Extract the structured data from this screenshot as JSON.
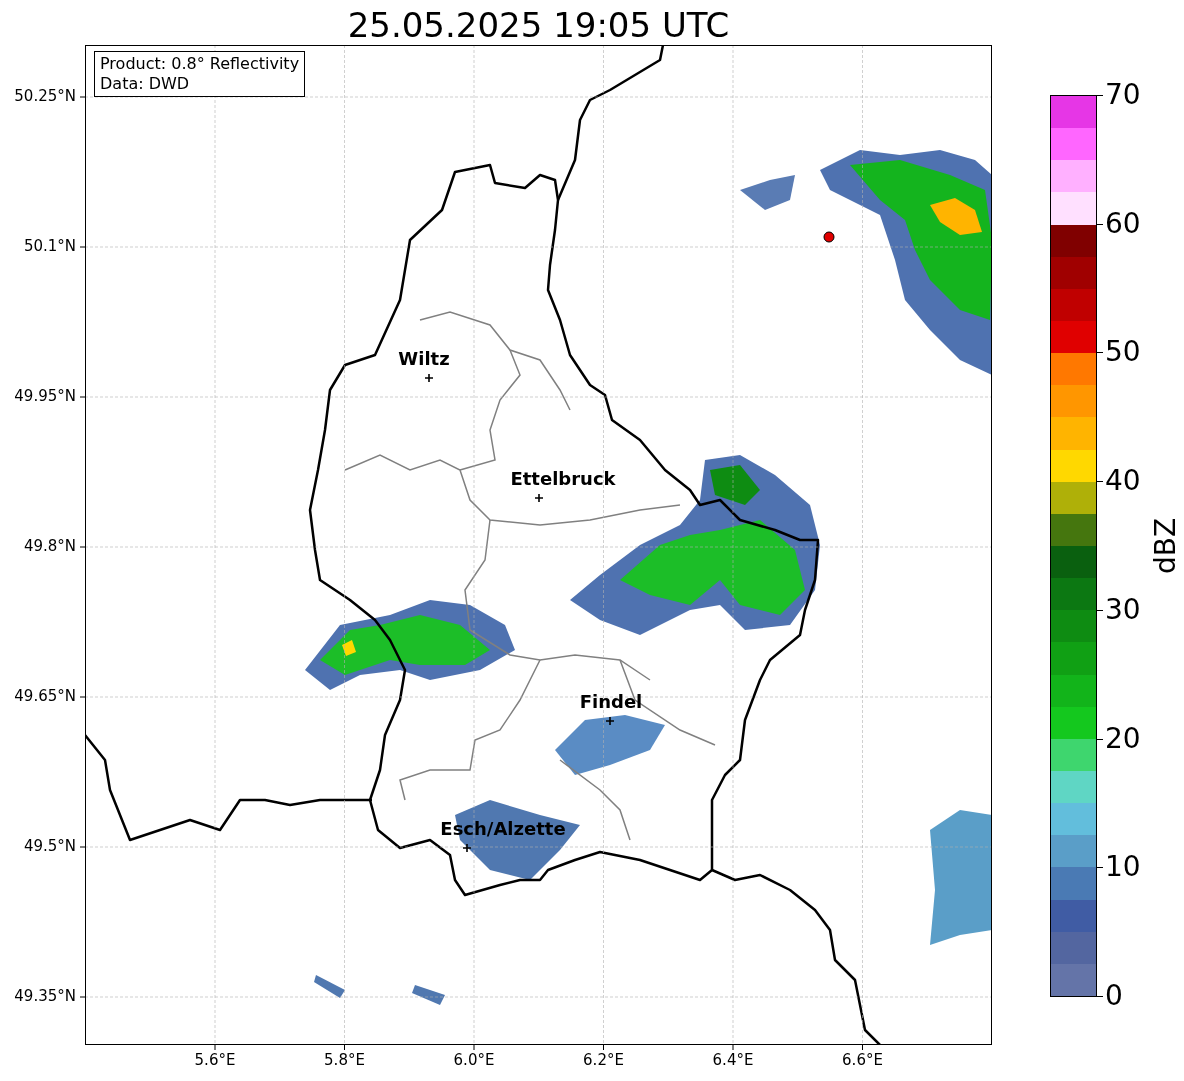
{
  "title": "25.05.2025 19:05 UTC",
  "info_box": {
    "lines": [
      "Product: 0.8° Reflectivity",
      "Data: DWD"
    ]
  },
  "map": {
    "yticks": [
      "50.25°N",
      "50.1°N",
      "49.95°N",
      "49.8°N",
      "49.65°N",
      "49.5°N",
      "49.35°N"
    ],
    "xticks": [
      "5.6°E",
      "5.8°E",
      "6.0°E",
      "6.2°E",
      "6.4°E",
      "6.6°E"
    ],
    "cities": [
      {
        "name": "Wiltz"
      },
      {
        "name": "Ettelbruck"
      },
      {
        "name": "Findel"
      },
      {
        "name": "Esch/Alzette"
      }
    ]
  },
  "colorbar": {
    "label": "dBZ",
    "ticks": [
      "70",
      "60",
      "50",
      "40",
      "30",
      "20",
      "10",
      "0"
    ],
    "bins": [
      {
        "color": "#e636e6"
      },
      {
        "color": "#ff66ff"
      },
      {
        "color": "#ffb0ff"
      },
      {
        "color": "#ffe0ff"
      },
      {
        "color": "#800000"
      },
      {
        "color": "#a00000"
      },
      {
        "color": "#c00000"
      },
      {
        "color": "#e00000"
      },
      {
        "color": "#ff7800"
      },
      {
        "color": "#ff9600"
      },
      {
        "color": "#ffb400"
      },
      {
        "color": "#ffd800"
      },
      {
        "color": "#afb008"
      },
      {
        "color": "#45760e"
      },
      {
        "color": "#0a600f"
      },
      {
        "color": "#0c7812"
      },
      {
        "color": "#0e8c12"
      },
      {
        "color": "#10a014"
      },
      {
        "color": "#12b41a"
      },
      {
        "color": "#14c81e"
      },
      {
        "color": "#3ed66e"
      },
      {
        "color": "#5fd6c4"
      },
      {
        "color": "#62bedc"
      },
      {
        "color": "#5a9ec8"
      },
      {
        "color": "#4a7ab4"
      },
      {
        "color": "#405ca4"
      },
      {
        "color": "#5366a0"
      },
      {
        "color": "#6474a8"
      }
    ]
  }
}
